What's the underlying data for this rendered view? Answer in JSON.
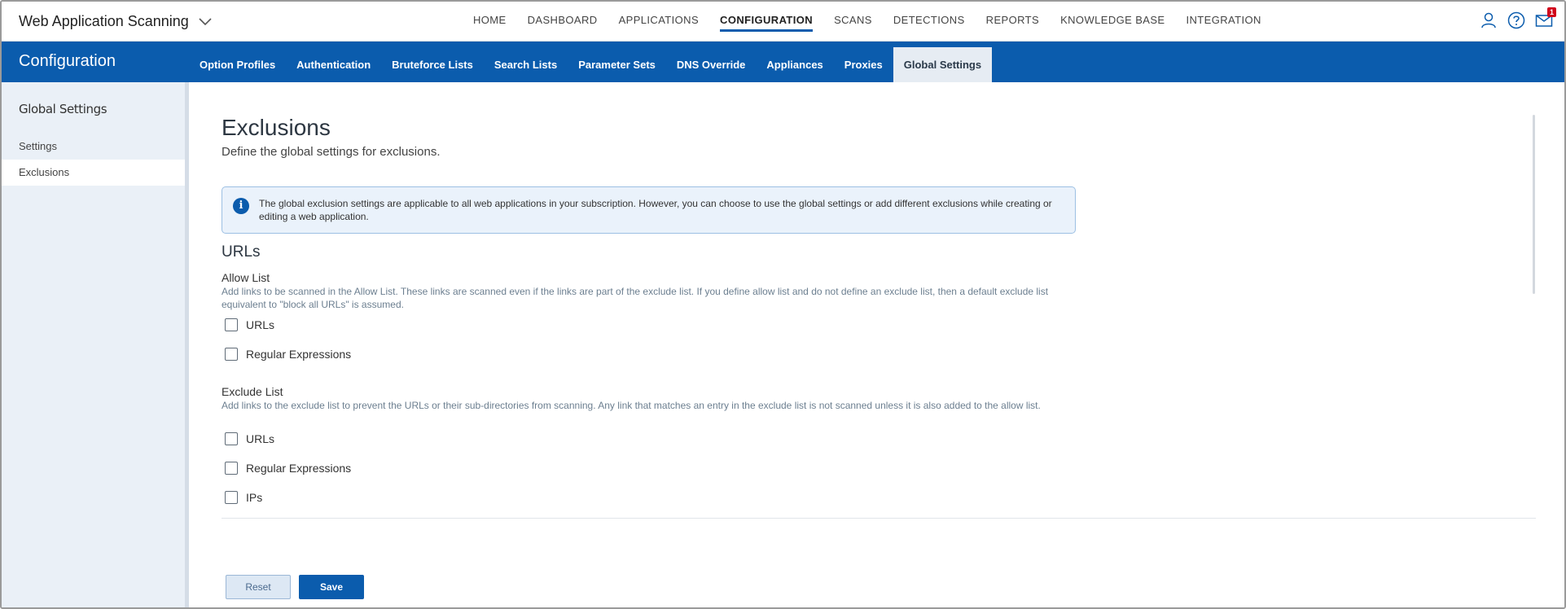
{
  "header": {
    "app_title": "Web Application Scanning",
    "nav": [
      "HOME",
      "DASHBOARD",
      "APPLICATIONS",
      "CONFIGURATION",
      "SCANS",
      "DETECTIONS",
      "REPORTS",
      "KNOWLEDGE BASE",
      "INTEGRATION"
    ],
    "active_nav": "CONFIGURATION",
    "notification_count": "1",
    "icons": [
      "user-icon",
      "help-icon",
      "mail-icon"
    ]
  },
  "subheader": {
    "title": "Configuration",
    "tabs": [
      "Option Profiles",
      "Authentication",
      "Bruteforce Lists",
      "Search Lists",
      "Parameter Sets",
      "DNS Override",
      "Appliances",
      "Proxies",
      "Global Settings"
    ],
    "active_tab": "Global Settings"
  },
  "sidebar": {
    "heading": "Global Settings",
    "items": [
      "Settings",
      "Exclusions"
    ],
    "active_item": "Exclusions"
  },
  "main": {
    "title": "Exclusions",
    "subtitle": "Define the global settings for exclusions.",
    "info_text": "The global exclusion settings are applicable to all web applications in your subscription. However, you can choose to use the global settings or add different exclusions while creating or editing a web application.",
    "urls_heading": "URLs",
    "allow_list": {
      "title": "Allow List",
      "description": "Add links to be scanned in the Allow List. These links are scanned even if the links are part of the exclude list. If you define allow list and do not define an exclude list, then a default exclude list equivalent to \"block all URLs\" is assumed.",
      "options": [
        "URLs",
        "Regular Expressions"
      ]
    },
    "exclude_list": {
      "title": "Exclude List",
      "description": "Add links to the exclude list to prevent the URLs or their sub-directories from scanning. Any link that matches an entry in the exclude list is not scanned unless it is also added to the allow list.",
      "options": [
        "URLs",
        "Regular Expressions",
        "IPs"
      ]
    },
    "buttons": {
      "reset": "Reset",
      "save": "Save"
    }
  },
  "colors": {
    "brand_blue": "#0b5cad",
    "sidebar_bg": "#eaf0f7",
    "info_bg": "#eaf2fb"
  }
}
